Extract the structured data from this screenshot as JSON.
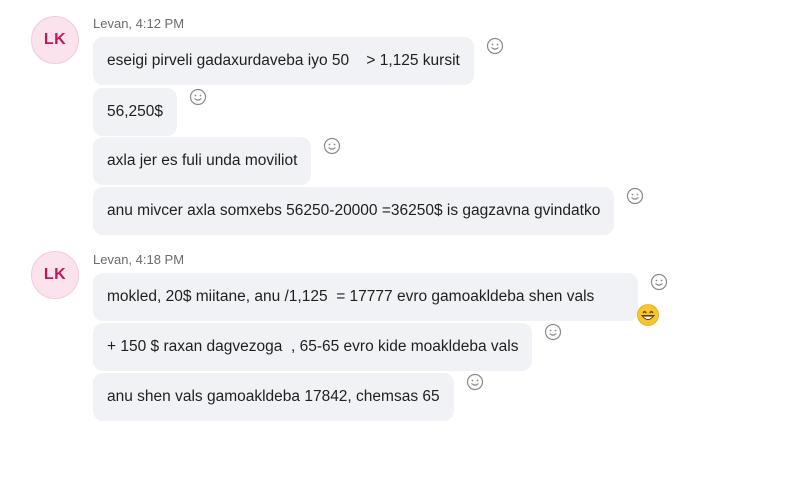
{
  "groups": [
    {
      "avatar_initials": "LK",
      "sender": "Levan, 4:12 PM",
      "messages": [
        "eseigi pirveli gadaxurdaveba iyo 50    > 1,125 kursit",
        "56,250$",
        "axla jer es fuli unda moviliot",
        "anu mivcer axla somxebs 56250-20000 =36250$ is gagzavna gvindatko"
      ]
    },
    {
      "avatar_initials": "LK",
      "sender": "Levan, 4:18 PM",
      "messages": [
        "mokled, 20$ miitane, anu /1,125  = 17777 evro gamoakldeba shen vals",
        "+ 150 $ raxan dagvezoga  , 65-65 evro kide moakldeba vals",
        "anu shen vals gamoakldeba 17842, chemsas 65"
      ]
    }
  ],
  "icons": {
    "reaction": "smiley-reaction-icon",
    "grin_emoji": "grinning-face-emoji"
  },
  "colors": {
    "bubble_bg": "#f0f2f5",
    "avatar_bg": "#fbe3ee",
    "avatar_text": "#c2185b"
  }
}
